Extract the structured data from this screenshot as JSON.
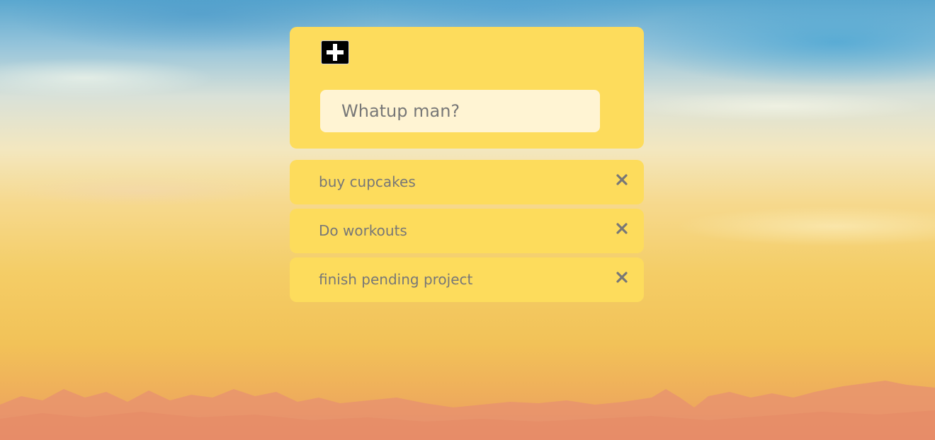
{
  "header": {
    "add_icon": "plus-icon",
    "input_placeholder": "Whatup man?",
    "input_value": ""
  },
  "todos": [
    {
      "text": "buy cupcakes",
      "delete_icon": "close-icon"
    },
    {
      "text": "Do workouts",
      "delete_icon": "close-icon"
    },
    {
      "text": "finish pending project",
      "delete_icon": "close-icon"
    }
  ],
  "colors": {
    "card": "#fddc5c",
    "input_bg": "#fff4d3",
    "text": "#777777"
  }
}
